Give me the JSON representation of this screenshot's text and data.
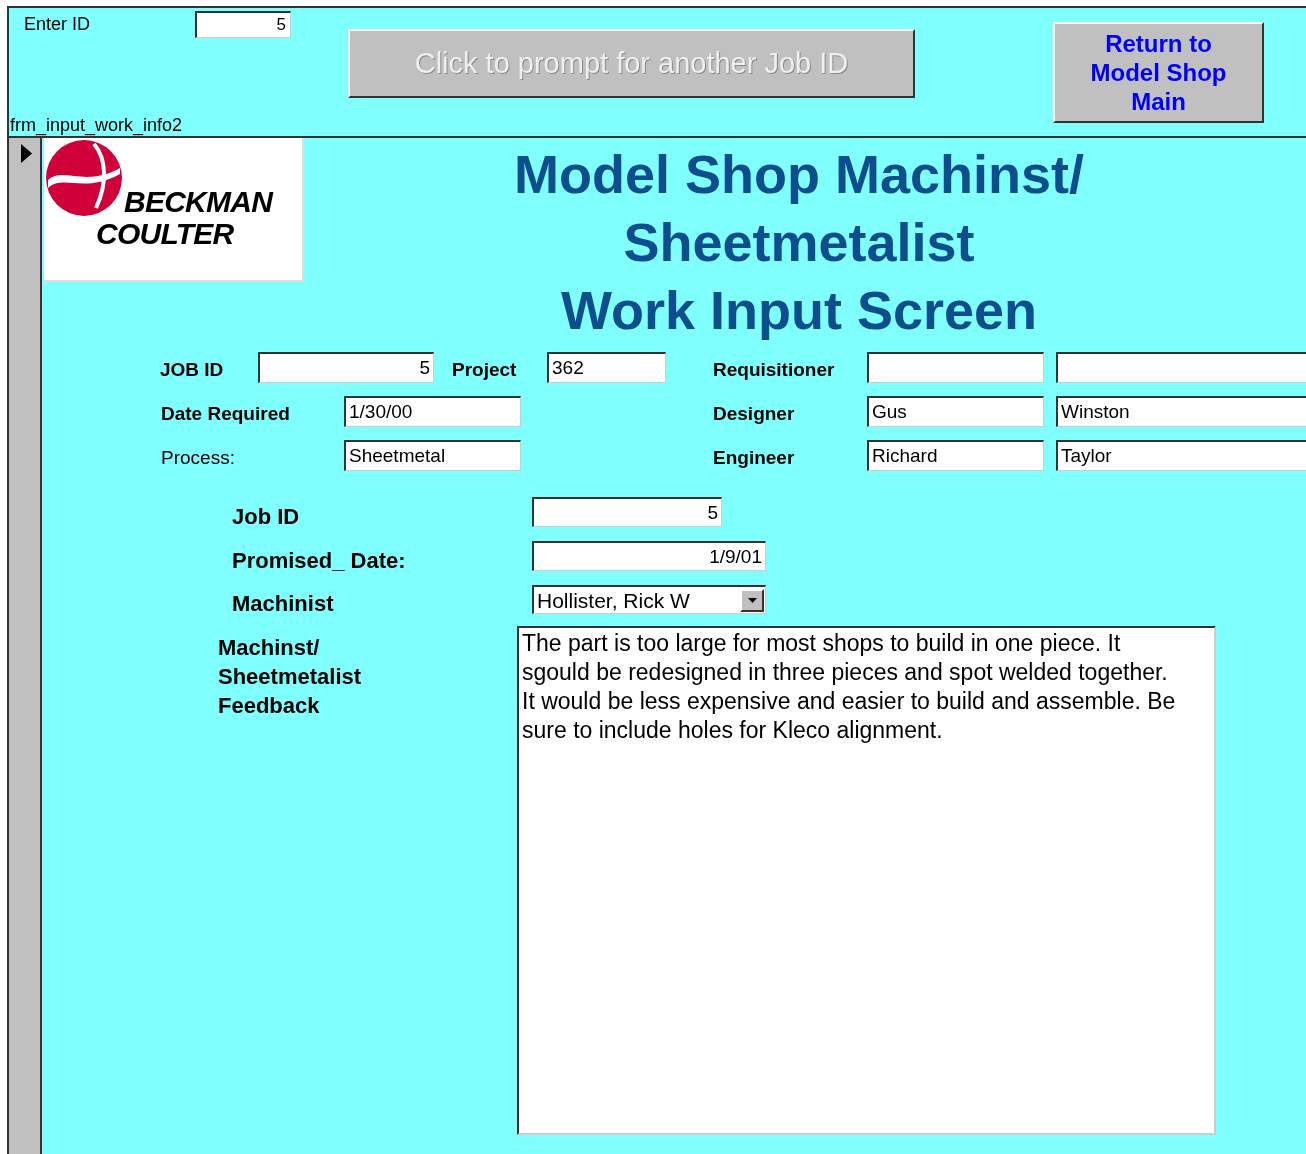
{
  "form_header": {
    "enter_id": {
      "label": "Enter ID",
      "value": "5"
    },
    "prompt_button": {
      "label": "Click to prompt for another Job ID",
      "disabled": true
    },
    "return_button": {
      "label": "Return to Model Shop Main"
    },
    "form_name": "frm_input_work_info2"
  },
  "logo": {
    "lines": [
      "BECKMAN",
      "COULTER"
    ]
  },
  "title_lines": [
    "Model Shop Machinst/",
    "Sheetmetalist",
    "Work Input Screen"
  ],
  "job_info": {
    "job_id": {
      "label": "JOB ID",
      "value": "5"
    },
    "project": {
      "label": "Project",
      "value": "362"
    },
    "date_required": {
      "label": "Date Required",
      "value": "1/30/00"
    },
    "process": {
      "label": "Process:",
      "value": "Sheetmetal"
    },
    "people": [
      {
        "label": "Requisitioner"
      },
      {
        "label": "Designer",
        "first": "Gus",
        "last": "Winston"
      },
      {
        "label": "Engineer",
        "first": "Richard",
        "last": "Taylor"
      }
    ]
  },
  "machinist_section": {
    "job_id": {
      "label": "Job ID",
      "value": "5"
    },
    "promised_date": {
      "label": "Promised_ Date:",
      "value": "1/9/01"
    },
    "machinist": {
      "label": "Machinist",
      "value": "Hollister, Rick W"
    },
    "feedback": {
      "label_lines": [
        "Machinst/",
        "Sheetmetalist",
        "Feedback"
      ],
      "value": "The part is too large for most shops to build in one piece. It sgould be redesigned in three pieces and spot welded together.  It would be less expensive and easier to build and assemble. Be sure to include holes for Kleco alignment."
    }
  }
}
